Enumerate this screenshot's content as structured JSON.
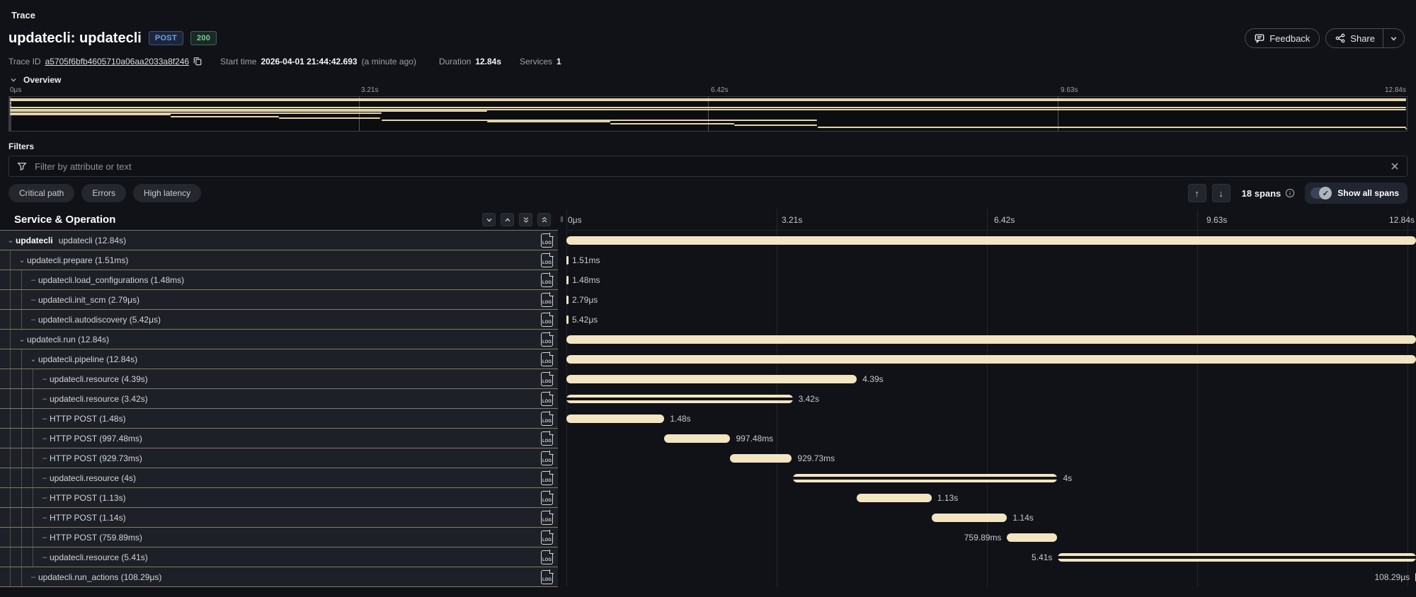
{
  "page": {
    "title": "Trace"
  },
  "header": {
    "title": "updatecli: updatecli",
    "method_badge": "POST",
    "status_badge": "200",
    "feedback_label": "Feedback",
    "share_label": "Share",
    "meta": {
      "trace_id_label": "Trace ID",
      "trace_id": "a5705f6bfb4605710a06aa2033a8f246",
      "start_time_label": "Start time",
      "start_time": "2026-04-01 21:44:42.693",
      "start_time_relative": "(a minute ago)",
      "duration_label": "Duration",
      "duration": "12.84s",
      "services_label": "Services",
      "services": "1"
    }
  },
  "overview": {
    "title": "Overview",
    "ticks": [
      "0μs",
      "3.21s",
      "6.42s",
      "9.63s",
      "12.84s"
    ],
    "tick_positions_pct": [
      0,
      25,
      50,
      75,
      100
    ]
  },
  "filters": {
    "label": "Filters",
    "placeholder": "Filter by attribute or text",
    "chips": [
      "Critical path",
      "Errors",
      "High latency"
    ],
    "span_count": "18 spans",
    "show_all_label": "Show all spans"
  },
  "table": {
    "header": "Service & Operation",
    "duration_s": 12.84,
    "rows": [
      {
        "service": "updatecli",
        "label": "updatecli (12.84s)",
        "depth": 0,
        "toggle": "chevron",
        "bar": {
          "start": 0,
          "end": 12.84,
          "style": "solid"
        },
        "bar_label": "",
        "label_side": "none"
      },
      {
        "label": "updatecli.prepare (1.51ms)",
        "depth": 1,
        "toggle": "chevron",
        "bar": {
          "start": 0,
          "end": 0.00151,
          "style": "tick"
        },
        "bar_label": "1.51ms",
        "label_side": "right"
      },
      {
        "label": "updatecli.load_configurations (1.48ms)",
        "depth": 2,
        "toggle": "dash",
        "bar": {
          "start": 0,
          "end": 0.00148,
          "style": "tick"
        },
        "bar_label": "1.48ms",
        "label_side": "right"
      },
      {
        "label": "updatecli.init_scm (2.79μs)",
        "depth": 2,
        "toggle": "dash",
        "bar": {
          "start": 0,
          "end": 2.8e-06,
          "style": "tick"
        },
        "bar_label": "2.79μs",
        "label_side": "right"
      },
      {
        "label": "updatecli.autodiscovery (5.42μs)",
        "depth": 2,
        "toggle": "dash",
        "bar": {
          "start": 0,
          "end": 5.4e-06,
          "style": "tick"
        },
        "bar_label": "5.42μs",
        "label_side": "right"
      },
      {
        "label": "updatecli.run (12.84s)",
        "depth": 1,
        "toggle": "chevron",
        "bar": {
          "start": 0,
          "end": 12.84,
          "style": "solid"
        },
        "bar_label": "",
        "label_side": "none"
      },
      {
        "label": "updatecli.pipeline (12.84s)",
        "depth": 2,
        "toggle": "chevron",
        "bar": {
          "start": 0,
          "end": 12.84,
          "style": "solid"
        },
        "bar_label": "",
        "label_side": "none"
      },
      {
        "label": "updatecli.resource (4.39s)",
        "depth": 3,
        "toggle": "dash",
        "bar": {
          "start": 0,
          "end": 4.39,
          "style": "solid"
        },
        "bar_label": "4.39s",
        "label_side": "right"
      },
      {
        "label": "updatecli.resource (3.42s)",
        "depth": 3,
        "toggle": "dash",
        "bar": {
          "start": 0,
          "end": 3.42,
          "style": "striped"
        },
        "bar_label": "3.42s",
        "label_side": "right"
      },
      {
        "label": "HTTP POST (1.48s)",
        "depth": 3,
        "toggle": "dash",
        "bar": {
          "start": 0,
          "end": 1.48,
          "style": "solid"
        },
        "bar_label": "1.48s",
        "label_side": "right"
      },
      {
        "label": "HTTP POST (997.48ms)",
        "depth": 3,
        "toggle": "dash",
        "bar": {
          "start": 1.48,
          "end": 2.477,
          "style": "solid"
        },
        "bar_label": "997.48ms",
        "label_side": "right"
      },
      {
        "label": "HTTP POST (929.73ms)",
        "depth": 3,
        "toggle": "dash",
        "bar": {
          "start": 2.477,
          "end": 3.407,
          "style": "solid"
        },
        "bar_label": "929.73ms",
        "label_side": "right"
      },
      {
        "label": "updatecli.resource (4s)",
        "depth": 3,
        "toggle": "dash",
        "bar": {
          "start": 3.42,
          "end": 7.42,
          "style": "striped"
        },
        "bar_label": "4s",
        "label_side": "right"
      },
      {
        "label": "HTTP POST (1.13s)",
        "depth": 3,
        "toggle": "dash",
        "bar": {
          "start": 4.39,
          "end": 5.52,
          "style": "solid"
        },
        "bar_label": "1.13s",
        "label_side": "right"
      },
      {
        "label": "HTTP POST (1.14s)",
        "depth": 3,
        "toggle": "dash",
        "bar": {
          "start": 5.52,
          "end": 6.66,
          "style": "solid"
        },
        "bar_label": "1.14s",
        "label_side": "right"
      },
      {
        "label": "HTTP POST (759.89ms)",
        "depth": 3,
        "toggle": "dash",
        "bar": {
          "start": 6.66,
          "end": 7.42,
          "style": "solid"
        },
        "bar_label": "759.89ms",
        "label_side": "left"
      },
      {
        "label": "updatecli.resource (5.41s)",
        "depth": 3,
        "toggle": "dash",
        "bar": {
          "start": 7.43,
          "end": 12.84,
          "style": "striped"
        },
        "bar_label": "5.41s",
        "label_side": "left"
      },
      {
        "label": "updatecli.run_actions (108.29μs)",
        "depth": 2,
        "toggle": "dash",
        "bar": {
          "start": 12.8305,
          "end": 12.84,
          "style": "tick"
        },
        "bar_label": "108.29μs",
        "label_side": "left"
      }
    ]
  },
  "colors": {
    "span_bar": "#f3e5c2",
    "row_separator": "#d8c59a",
    "accent_blue": "#6e9fff",
    "accent_green": "#73d19a",
    "background": "#111217"
  }
}
